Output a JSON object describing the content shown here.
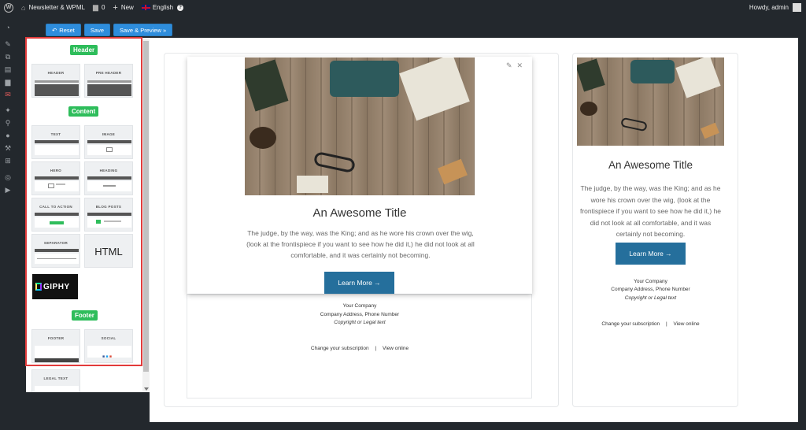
{
  "adminbar": {
    "site_name": "Newsletter & WPML",
    "comments_count": "0",
    "new_label": "New",
    "language": "English",
    "howdy": "Howdy, admin"
  },
  "toolbar": {
    "reset_label": "Reset",
    "save_label": "Save",
    "save_preview_label": "Save & Preview »"
  },
  "blocks": {
    "header_section": "Header",
    "content_section": "Content",
    "footer_section": "Footer",
    "header_block": "HEADER",
    "preheader_block": "PRE HEADER",
    "text_block": "TEXT",
    "image_block": "IMAGE",
    "hero_block": "HERO",
    "heading_block": "HEADING",
    "cta_block": "CALL TO ACTION",
    "blogposts_block": "BLOG POSTS",
    "separator_block": "SEPARATOR",
    "html_block": "HTML",
    "giphy_block": "GIPHY",
    "footer_block": "FOOTER",
    "social_block": "SOCIAL",
    "legal_block": "LEGAL TEXT"
  },
  "email": {
    "title": "An Awesome Title",
    "body": "The judge, by the way, was the King; and as he wore his crown over the wig, (look at the frontispiece if you want to see how he did it,) he did not look at all comfortable, and it was certainly not becoming.",
    "button": "Learn More →",
    "company": "Your Company",
    "address": "Company Address, Phone Number",
    "legal": "Copyright or Legal text",
    "change_subscription": "Change your subscription",
    "separator": "|",
    "view_online": "View online"
  },
  "colors": {
    "accent": "#2e8ddc",
    "badge": "#2ebd5b",
    "email_button": "#256f9c",
    "highlight": "#e23b3b"
  }
}
